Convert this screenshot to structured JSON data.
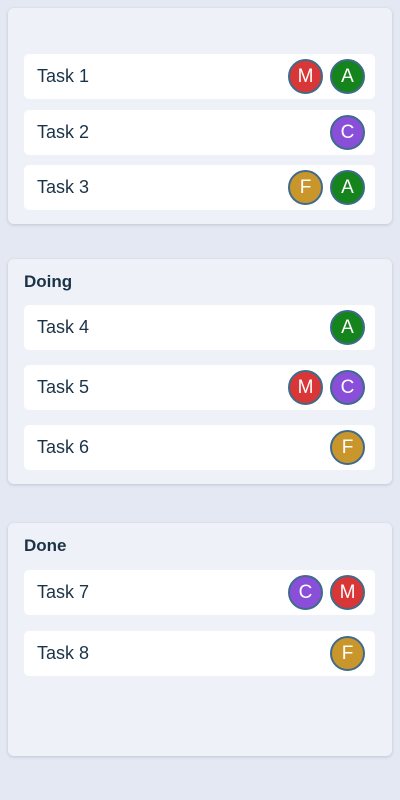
{
  "columns": [
    {
      "title": "",
      "cards": [
        {
          "label": "Task 1",
          "assignees": [
            "A",
            "M"
          ]
        },
        {
          "label": "Task 2",
          "assignees": [
            "C"
          ]
        },
        {
          "label": "Task 3",
          "assignees": [
            "A",
            "F"
          ]
        }
      ]
    },
    {
      "title": "Doing",
      "cards": [
        {
          "label": "Task 4",
          "assignees": [
            "A"
          ]
        },
        {
          "label": "Task 5",
          "assignees": [
            "C",
            "M"
          ]
        },
        {
          "label": "Task 6",
          "assignees": [
            "F"
          ]
        }
      ]
    },
    {
      "title": "Done",
      "cards": [
        {
          "label": "Task 7",
          "assignees": [
            "M",
            "C"
          ]
        },
        {
          "label": "Task 8",
          "assignees": [
            "F"
          ]
        }
      ]
    }
  ],
  "colors": {
    "background": "#e3e8f2",
    "column": "#eef2f8",
    "card": "#ffffff",
    "text": "#1c3347",
    "avatar_border": "#3e6b8c",
    "avatar_A": "#16841c",
    "avatar_M": "#d93637",
    "avatar_C": "#8a4fd8",
    "avatar_F": "#c9962c"
  }
}
